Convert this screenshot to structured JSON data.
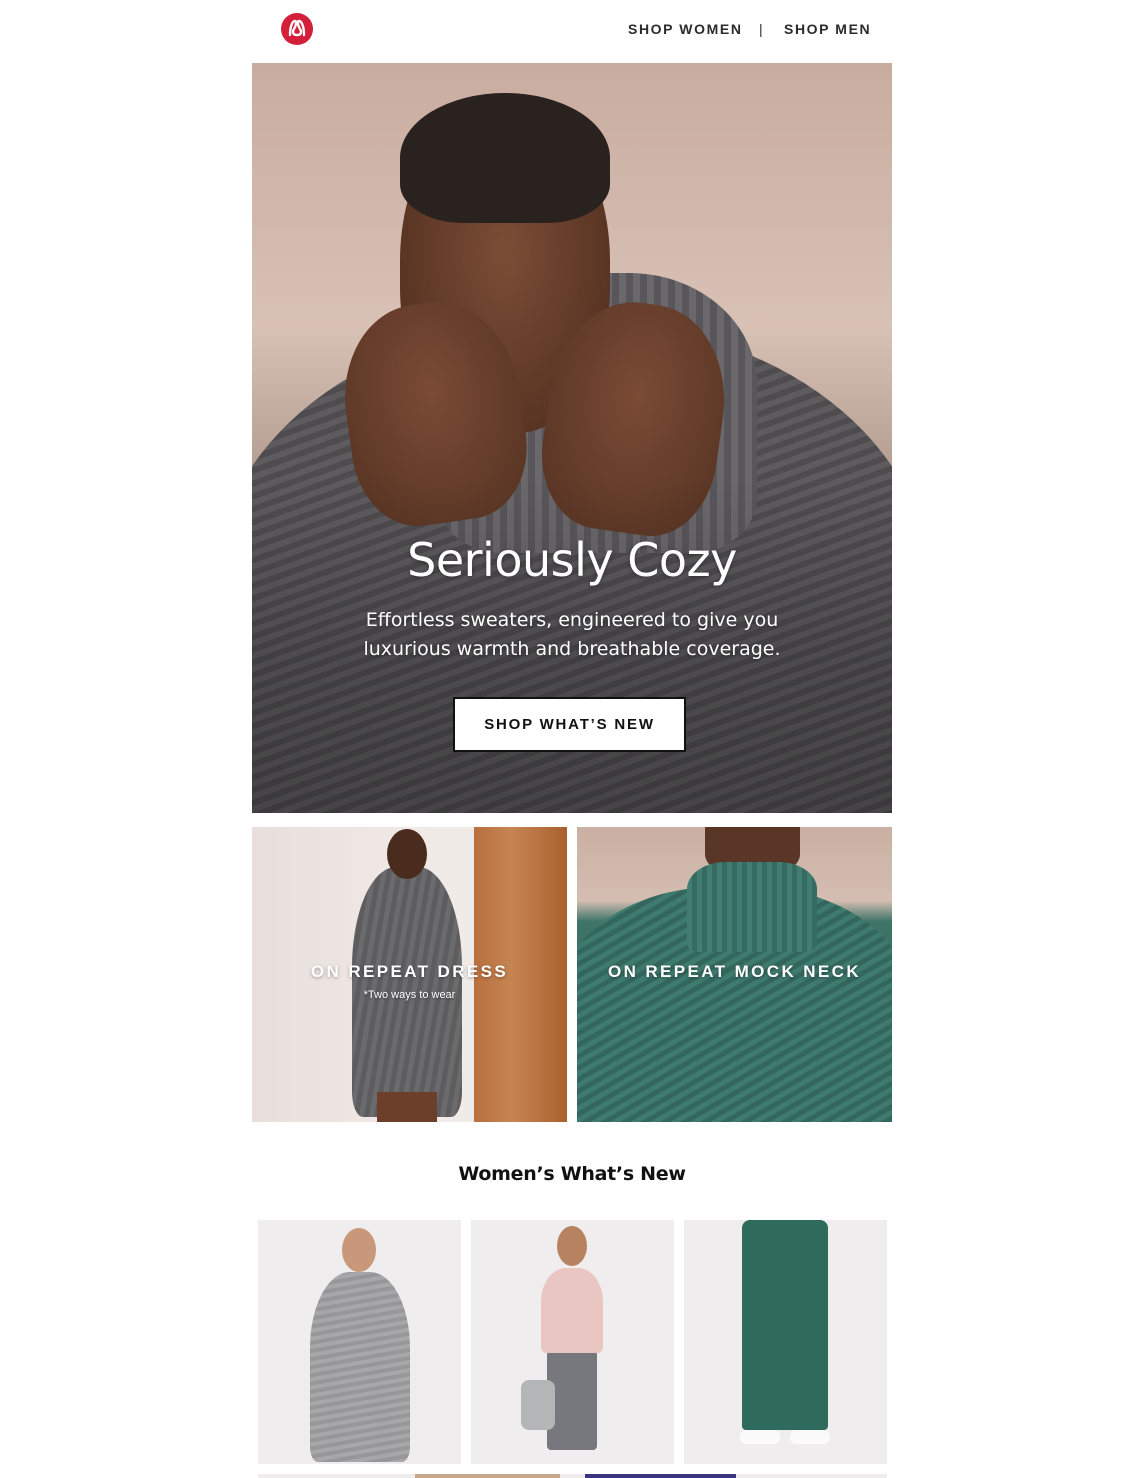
{
  "header": {
    "nav_women": "SHOP WOMEN",
    "nav_separator": "|",
    "nav_men": "SHOP MEN"
  },
  "hero": {
    "title": "Seriously Cozy",
    "subtitle": "Effortless sweaters, engineered to give you luxurious warmth and breathable coverage.",
    "cta": "SHOP WHAT’S NEW"
  },
  "tiles": [
    {
      "title": "ON REPEAT DRESS",
      "note": "*Two ways to wear"
    },
    {
      "title": "ON REPEAT MOCK NECK"
    }
  ],
  "section": {
    "title": "Women’s What’s New"
  },
  "colors": {
    "brand_red": "#d31f3a",
    "text": "#1a1a1a"
  },
  "icons": {
    "logo": "lululemon-logo-icon"
  }
}
